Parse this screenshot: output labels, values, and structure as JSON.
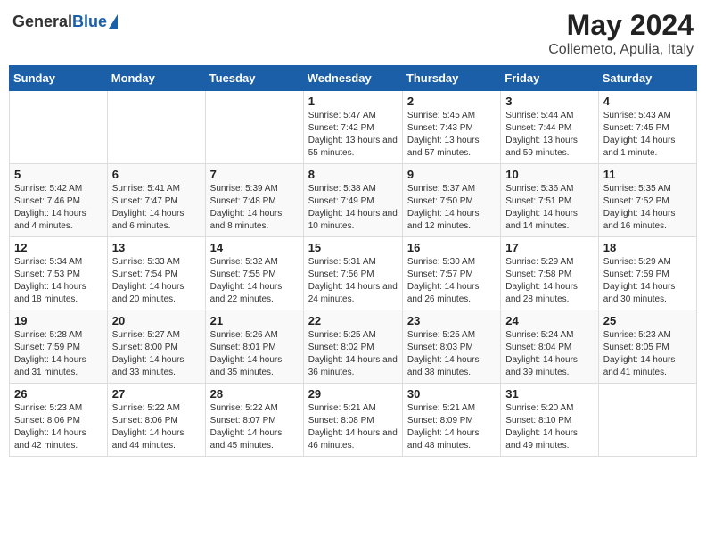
{
  "header": {
    "logo_general": "General",
    "logo_blue": "Blue",
    "month": "May 2024",
    "location": "Collemeto, Apulia, Italy"
  },
  "days_of_week": [
    "Sunday",
    "Monday",
    "Tuesday",
    "Wednesday",
    "Thursday",
    "Friday",
    "Saturday"
  ],
  "weeks": [
    [
      {
        "day": "",
        "info": ""
      },
      {
        "day": "",
        "info": ""
      },
      {
        "day": "",
        "info": ""
      },
      {
        "day": "1",
        "info": "Sunrise: 5:47 AM\nSunset: 7:42 PM\nDaylight: 13 hours and 55 minutes."
      },
      {
        "day": "2",
        "info": "Sunrise: 5:45 AM\nSunset: 7:43 PM\nDaylight: 13 hours and 57 minutes."
      },
      {
        "day": "3",
        "info": "Sunrise: 5:44 AM\nSunset: 7:44 PM\nDaylight: 13 hours and 59 minutes."
      },
      {
        "day": "4",
        "info": "Sunrise: 5:43 AM\nSunset: 7:45 PM\nDaylight: 14 hours and 1 minute."
      }
    ],
    [
      {
        "day": "5",
        "info": "Sunrise: 5:42 AM\nSunset: 7:46 PM\nDaylight: 14 hours and 4 minutes."
      },
      {
        "day": "6",
        "info": "Sunrise: 5:41 AM\nSunset: 7:47 PM\nDaylight: 14 hours and 6 minutes."
      },
      {
        "day": "7",
        "info": "Sunrise: 5:39 AM\nSunset: 7:48 PM\nDaylight: 14 hours and 8 minutes."
      },
      {
        "day": "8",
        "info": "Sunrise: 5:38 AM\nSunset: 7:49 PM\nDaylight: 14 hours and 10 minutes."
      },
      {
        "day": "9",
        "info": "Sunrise: 5:37 AM\nSunset: 7:50 PM\nDaylight: 14 hours and 12 minutes."
      },
      {
        "day": "10",
        "info": "Sunrise: 5:36 AM\nSunset: 7:51 PM\nDaylight: 14 hours and 14 minutes."
      },
      {
        "day": "11",
        "info": "Sunrise: 5:35 AM\nSunset: 7:52 PM\nDaylight: 14 hours and 16 minutes."
      }
    ],
    [
      {
        "day": "12",
        "info": "Sunrise: 5:34 AM\nSunset: 7:53 PM\nDaylight: 14 hours and 18 minutes."
      },
      {
        "day": "13",
        "info": "Sunrise: 5:33 AM\nSunset: 7:54 PM\nDaylight: 14 hours and 20 minutes."
      },
      {
        "day": "14",
        "info": "Sunrise: 5:32 AM\nSunset: 7:55 PM\nDaylight: 14 hours and 22 minutes."
      },
      {
        "day": "15",
        "info": "Sunrise: 5:31 AM\nSunset: 7:56 PM\nDaylight: 14 hours and 24 minutes."
      },
      {
        "day": "16",
        "info": "Sunrise: 5:30 AM\nSunset: 7:57 PM\nDaylight: 14 hours and 26 minutes."
      },
      {
        "day": "17",
        "info": "Sunrise: 5:29 AM\nSunset: 7:58 PM\nDaylight: 14 hours and 28 minutes."
      },
      {
        "day": "18",
        "info": "Sunrise: 5:29 AM\nSunset: 7:59 PM\nDaylight: 14 hours and 30 minutes."
      }
    ],
    [
      {
        "day": "19",
        "info": "Sunrise: 5:28 AM\nSunset: 7:59 PM\nDaylight: 14 hours and 31 minutes."
      },
      {
        "day": "20",
        "info": "Sunrise: 5:27 AM\nSunset: 8:00 PM\nDaylight: 14 hours and 33 minutes."
      },
      {
        "day": "21",
        "info": "Sunrise: 5:26 AM\nSunset: 8:01 PM\nDaylight: 14 hours and 35 minutes."
      },
      {
        "day": "22",
        "info": "Sunrise: 5:25 AM\nSunset: 8:02 PM\nDaylight: 14 hours and 36 minutes."
      },
      {
        "day": "23",
        "info": "Sunrise: 5:25 AM\nSunset: 8:03 PM\nDaylight: 14 hours and 38 minutes."
      },
      {
        "day": "24",
        "info": "Sunrise: 5:24 AM\nSunset: 8:04 PM\nDaylight: 14 hours and 39 minutes."
      },
      {
        "day": "25",
        "info": "Sunrise: 5:23 AM\nSunset: 8:05 PM\nDaylight: 14 hours and 41 minutes."
      }
    ],
    [
      {
        "day": "26",
        "info": "Sunrise: 5:23 AM\nSunset: 8:06 PM\nDaylight: 14 hours and 42 minutes."
      },
      {
        "day": "27",
        "info": "Sunrise: 5:22 AM\nSunset: 8:06 PM\nDaylight: 14 hours and 44 minutes."
      },
      {
        "day": "28",
        "info": "Sunrise: 5:22 AM\nSunset: 8:07 PM\nDaylight: 14 hours and 45 minutes."
      },
      {
        "day": "29",
        "info": "Sunrise: 5:21 AM\nSunset: 8:08 PM\nDaylight: 14 hours and 46 minutes."
      },
      {
        "day": "30",
        "info": "Sunrise: 5:21 AM\nSunset: 8:09 PM\nDaylight: 14 hours and 48 minutes."
      },
      {
        "day": "31",
        "info": "Sunrise: 5:20 AM\nSunset: 8:10 PM\nDaylight: 14 hours and 49 minutes."
      },
      {
        "day": "",
        "info": ""
      }
    ]
  ]
}
